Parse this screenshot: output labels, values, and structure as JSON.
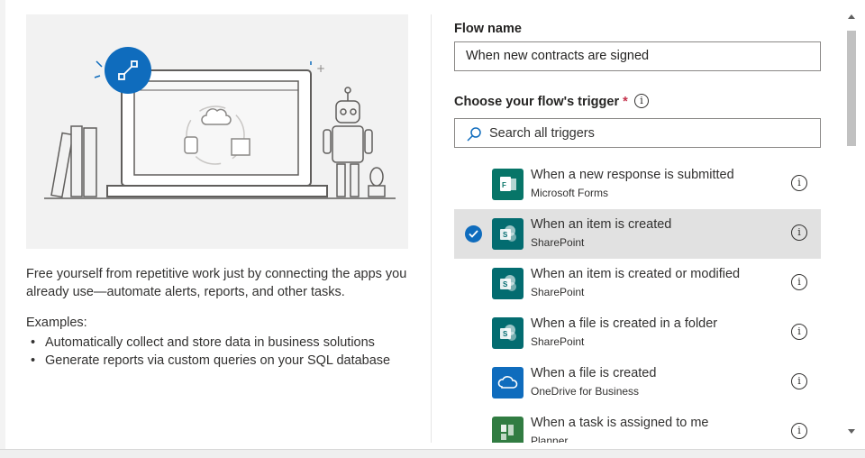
{
  "left": {
    "description": "Free yourself from repetitive work just by connecting the apps you already use—automate alerts, reports, and other tasks.",
    "examples_title": "Examples:",
    "examples": [
      "Automatically collect and store data in business solutions",
      "Generate reports via custom queries on your SQL database"
    ]
  },
  "form": {
    "flow_name_label": "Flow name",
    "flow_name_value": "When new contracts are signed",
    "trigger_label": "Choose your flow's trigger",
    "required_mark": "*",
    "info_glyph": "i",
    "search_placeholder": "Search all triggers"
  },
  "triggers": [
    {
      "title": "When a new response is submitted",
      "app": "Microsoft Forms",
      "icon": "forms-icon",
      "color": "#077568",
      "selected": false
    },
    {
      "title": "When an item is created",
      "app": "SharePoint",
      "icon": "sharepoint-icon",
      "color": "#036c70",
      "selected": true
    },
    {
      "title": "When an item is created or modified",
      "app": "SharePoint",
      "icon": "sharepoint-icon",
      "color": "#036c70",
      "selected": false
    },
    {
      "title": "When a file is created in a folder",
      "app": "SharePoint",
      "icon": "sharepoint-icon",
      "color": "#036c70",
      "selected": false
    },
    {
      "title": "When a file is created",
      "app": "OneDrive for Business",
      "icon": "onedrive-icon",
      "color": "#0f6cbd",
      "selected": false
    },
    {
      "title": "When a task is assigned to me",
      "app": "Planner",
      "icon": "planner-icon",
      "color": "#317c42",
      "selected": false
    }
  ],
  "colors": {
    "accent": "#0f6cbd",
    "selected_row": "#e1e1e1",
    "required": "#c4314b"
  }
}
